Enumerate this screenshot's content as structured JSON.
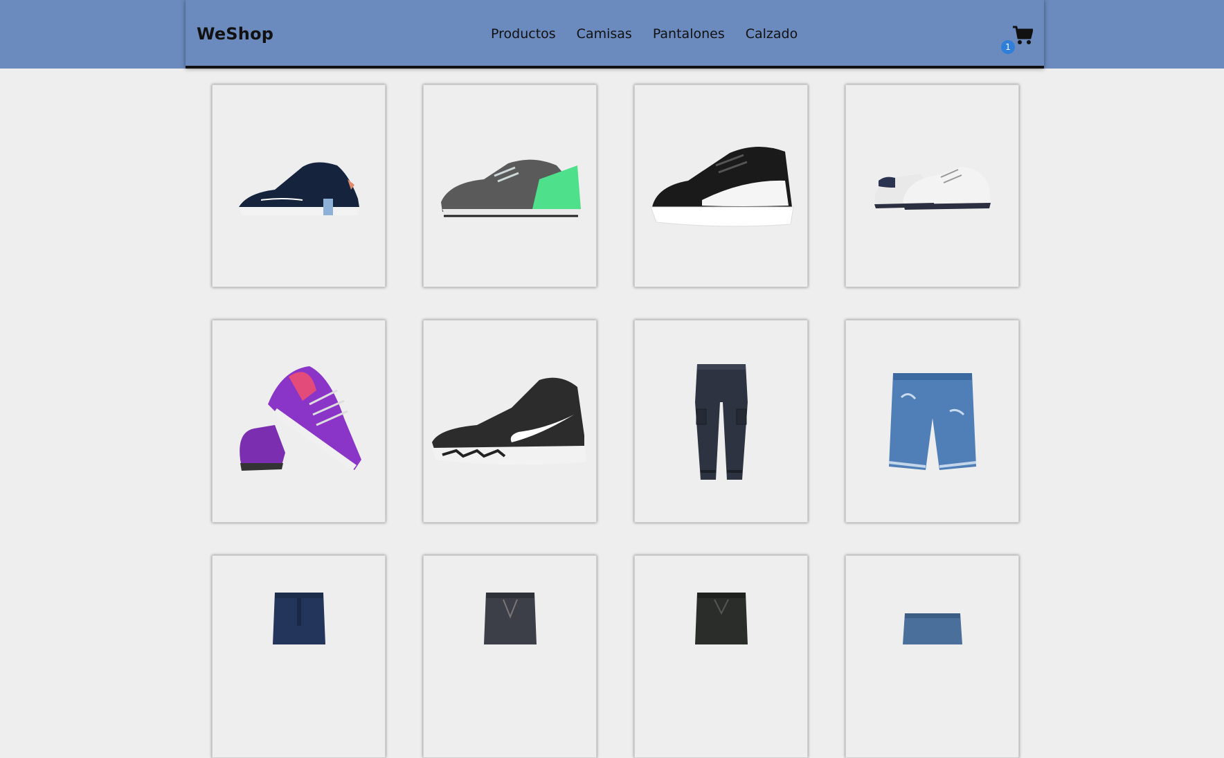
{
  "brand": "WeShop",
  "nav": {
    "items": [
      "Productos",
      "Camisas",
      "Pantalones",
      "Calzado"
    ]
  },
  "cart": {
    "count": "1",
    "icon": "shopping-cart-icon"
  },
  "colors": {
    "header": "#6b8abd",
    "background": "#eeeeee",
    "badge": "#2f7ed8"
  },
  "products": [
    {
      "image": "navy-sneaker-icon"
    },
    {
      "image": "grey-green-running-shoe-icon"
    },
    {
      "image": "black-white-low-sneaker-icon"
    },
    {
      "image": "white-sneakers-pair-icon"
    },
    {
      "image": "purple-running-shoes-pair-icon"
    },
    {
      "image": "black-high-top-sneaker-icon"
    },
    {
      "image": "dark-cargo-pants-icon"
    },
    {
      "image": "blue-denim-shorts-icon"
    },
    {
      "image": "dark-denim-shorts-icon"
    },
    {
      "image": "grey-cargo-shorts-icon"
    },
    {
      "image": "black-cargo-shorts-icon"
    },
    {
      "image": "light-denim-shorts-icon"
    }
  ]
}
